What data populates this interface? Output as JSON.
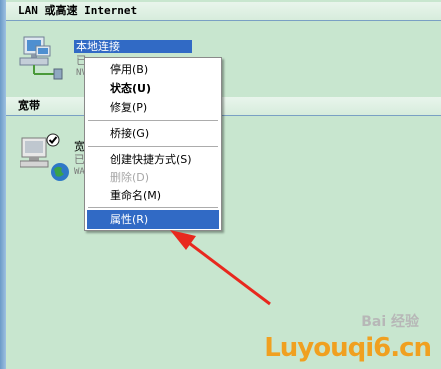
{
  "sections": {
    "lan_header": "LAN 或高速 Internet",
    "broadband_header": "宽带"
  },
  "lan_connection": {
    "name": "本地连接",
    "status_partial": "已",
    "device_partial": "NVI"
  },
  "broadband_connection": {
    "name_partial": "宽",
    "status_partial": "已",
    "device_partial": "WAN"
  },
  "context_menu": {
    "items": [
      {
        "label": "停用(B)"
      },
      {
        "label": "状态(U)"
      },
      {
        "label": "修复(P)"
      },
      {
        "label": "桥接(G)"
      },
      {
        "label": "创建快捷方式(S)"
      },
      {
        "label": "删除(D)"
      },
      {
        "label": "重命名(M)"
      },
      {
        "label": "属性(R)"
      }
    ]
  },
  "watermark": {
    "top_text": "Bai 经验",
    "bottom_text": "Luyouqi6.cn"
  },
  "colors": {
    "background": "#c8e6cf",
    "selection": "#316ac5",
    "arrow": "#e8281e"
  }
}
